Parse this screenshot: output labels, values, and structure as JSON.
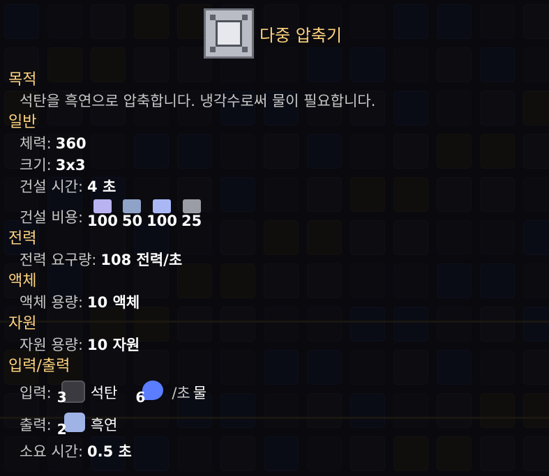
{
  "block": {
    "name": "다중 압축기",
    "icon": "multi-press-block-icon"
  },
  "sections": {
    "purpose": "목적",
    "general": "일반",
    "power": "전력",
    "liquids": "액체",
    "items": "자원",
    "io": "입력/출력"
  },
  "description": "석탄을 흑연으로 압축합니다. 냉각수로써 물이 필요합니다.",
  "stats": {
    "health_label": "체력:",
    "health_value": "360",
    "size_label": "크기:",
    "size_value": "3x3",
    "build_time_label": "건설 시간:",
    "build_time_value": "4 초",
    "build_cost_label": "건설 비용:",
    "build_cost": [
      {
        "icon": "titanium-icon",
        "amount": "100",
        "color": "#b9b3f2"
      },
      {
        "icon": "silicon-icon",
        "amount": "50",
        "color": "#8fa3c9"
      },
      {
        "icon": "thorium-icon",
        "amount": "100",
        "color": "#a9b8f5"
      },
      {
        "icon": "graphite-icon",
        "amount": "25",
        "color": "#9a9da5"
      }
    ],
    "power_use_label": "전력 요구량:",
    "power_use_value": "108 전력/초",
    "liquid_cap_label": "액체 용량:",
    "liquid_cap_value": "10 액체",
    "item_cap_label": "자원 용량:",
    "item_cap_value": "10 자원",
    "input_label": "입력:",
    "input_coal_count": "3",
    "input_coal_name": "석탄",
    "input_water_count": "6",
    "input_per": "/초",
    "input_water_name": "물",
    "output_label": "출력:",
    "output_count": "2",
    "output_name": "흑연",
    "craft_time_label": "소요 시간:",
    "craft_time_value": "0.5 초"
  },
  "colors": {
    "accent": "#ffd37f",
    "coal": "#3a3a40",
    "water": "#5b7dff",
    "graphite": "#9fb3e6"
  }
}
